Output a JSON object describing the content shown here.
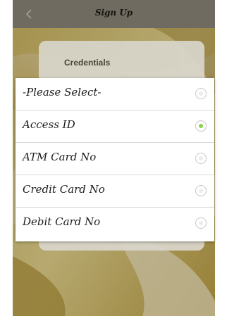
{
  "header": {
    "title": "Sign Up",
    "back_icon": "chevron-left-icon"
  },
  "card": {
    "title": "Credentials"
  },
  "selector": {
    "options": [
      {
        "label": "-Please Select-",
        "selected": false
      },
      {
        "label": "Access ID",
        "selected": true
      },
      {
        "label": "ATM Card No",
        "selected": false
      },
      {
        "label": "Credit Card No",
        "selected": false
      },
      {
        "label": "Debit Card No",
        "selected": false
      }
    ]
  },
  "colors": {
    "selected_radio": "#8bd44a",
    "header_bar": "#6f6b60"
  }
}
